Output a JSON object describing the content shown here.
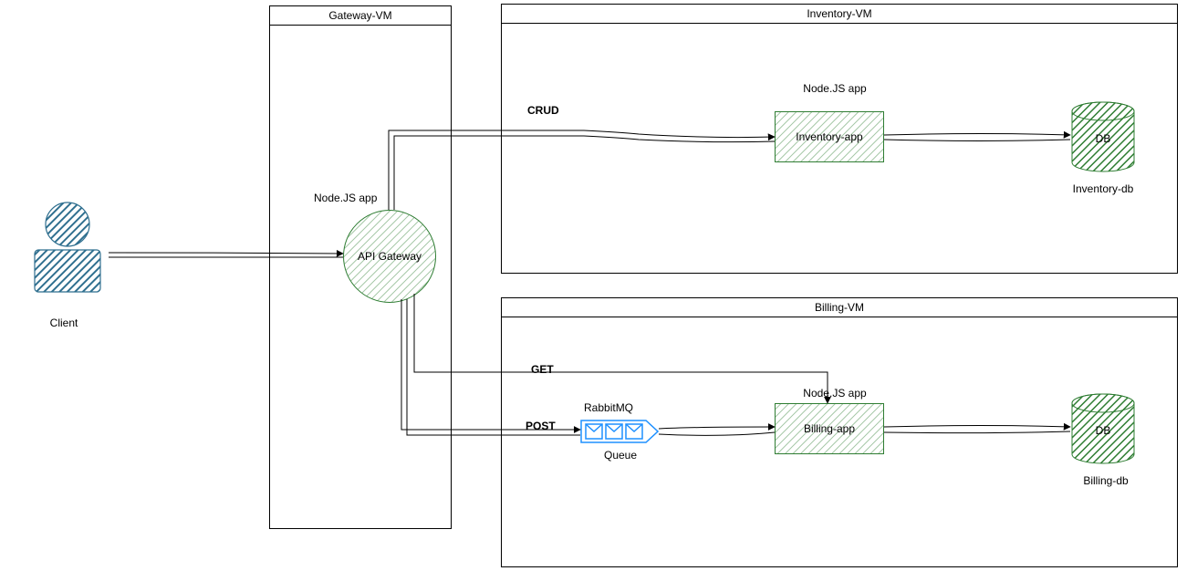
{
  "client_label": "Client",
  "gateway_vm": {
    "title": "Gateway-VM",
    "node_label_top": "Node.JS app",
    "circle_label": "API Gateway"
  },
  "inventory_vm": {
    "title": "Inventory-VM",
    "node_label": "Node.JS app",
    "app_label": "Inventory-app",
    "db_label": "DB",
    "db_caption": "Inventory-db"
  },
  "billing_vm": {
    "title": "Billing-VM",
    "node_label": "Node.JS app",
    "app_label": "Billing-app",
    "db_label": "DB",
    "db_caption": "Billing-db",
    "queue_top": "RabbitMQ",
    "queue_bottom": "Queue"
  },
  "edges": {
    "crud": "CRUD",
    "get": "GET",
    "post": "POST"
  }
}
